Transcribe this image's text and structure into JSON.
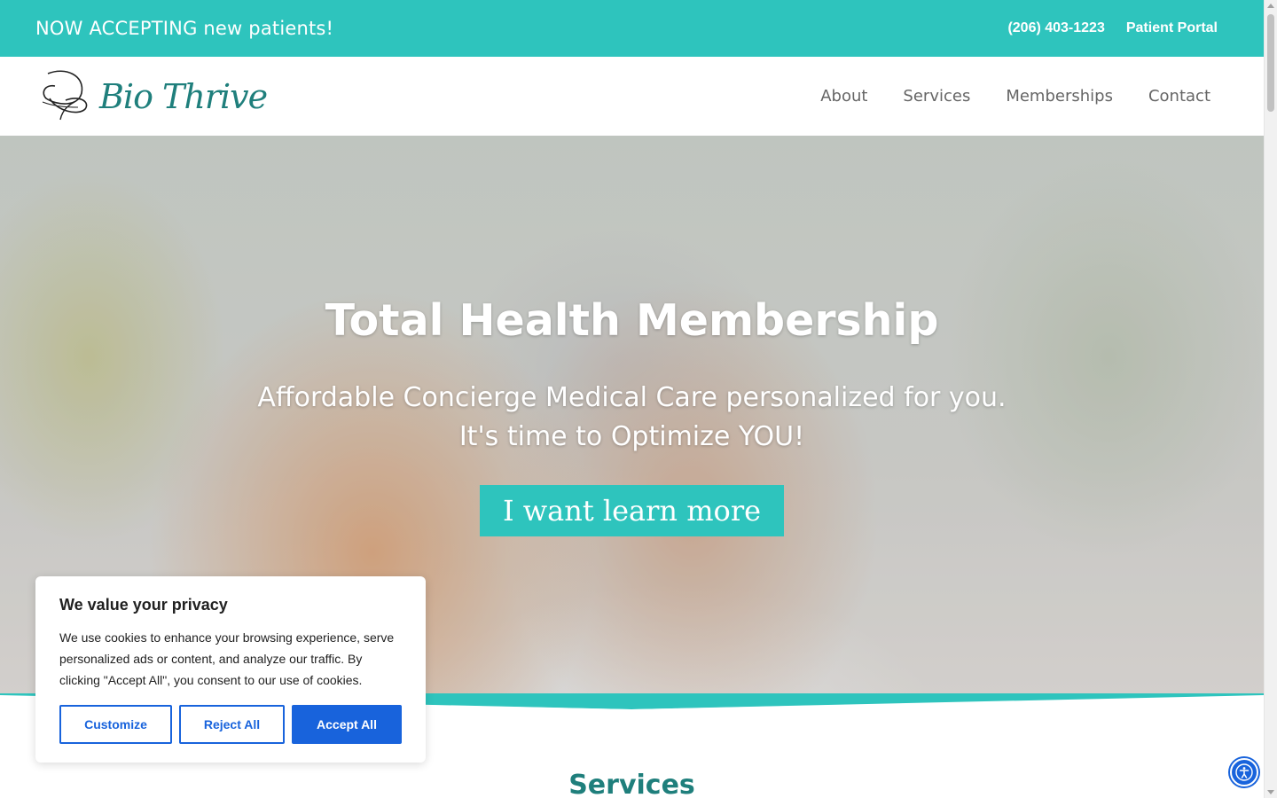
{
  "topbar": {
    "announcement": "NOW ACCEPTING new patients!",
    "phone": "(206) 403-1223",
    "portal": "Patient Portal"
  },
  "header": {
    "logo_text": "Bio Thrive",
    "nav": [
      "About",
      "Services",
      "Memberships",
      "Contact"
    ]
  },
  "hero": {
    "title": "Total Health Membership",
    "subtitle_line1": "Affordable Concierge Medical Care personalized for you.",
    "subtitle_line2": "It's time to Optimize YOU!",
    "cta": "I want learn more"
  },
  "services": {
    "title": "Services"
  },
  "cookie": {
    "title": "We value your privacy",
    "body": "We use cookies to enhance your browsing experience, serve personalized ads or content, and analyze our traffic. By clicking \"Accept All\", you consent to our use of cookies.",
    "customize": "Customize",
    "reject": "Reject All",
    "accept": "Accept All"
  },
  "icons": {
    "logo": "butterfly-logo-icon",
    "accessibility": "accessibility-icon"
  },
  "colors": {
    "teal": "#2ec4bd",
    "dark_teal": "#1f7f7c",
    "nav_gray": "#666666",
    "cookie_blue": "#1863dc"
  }
}
